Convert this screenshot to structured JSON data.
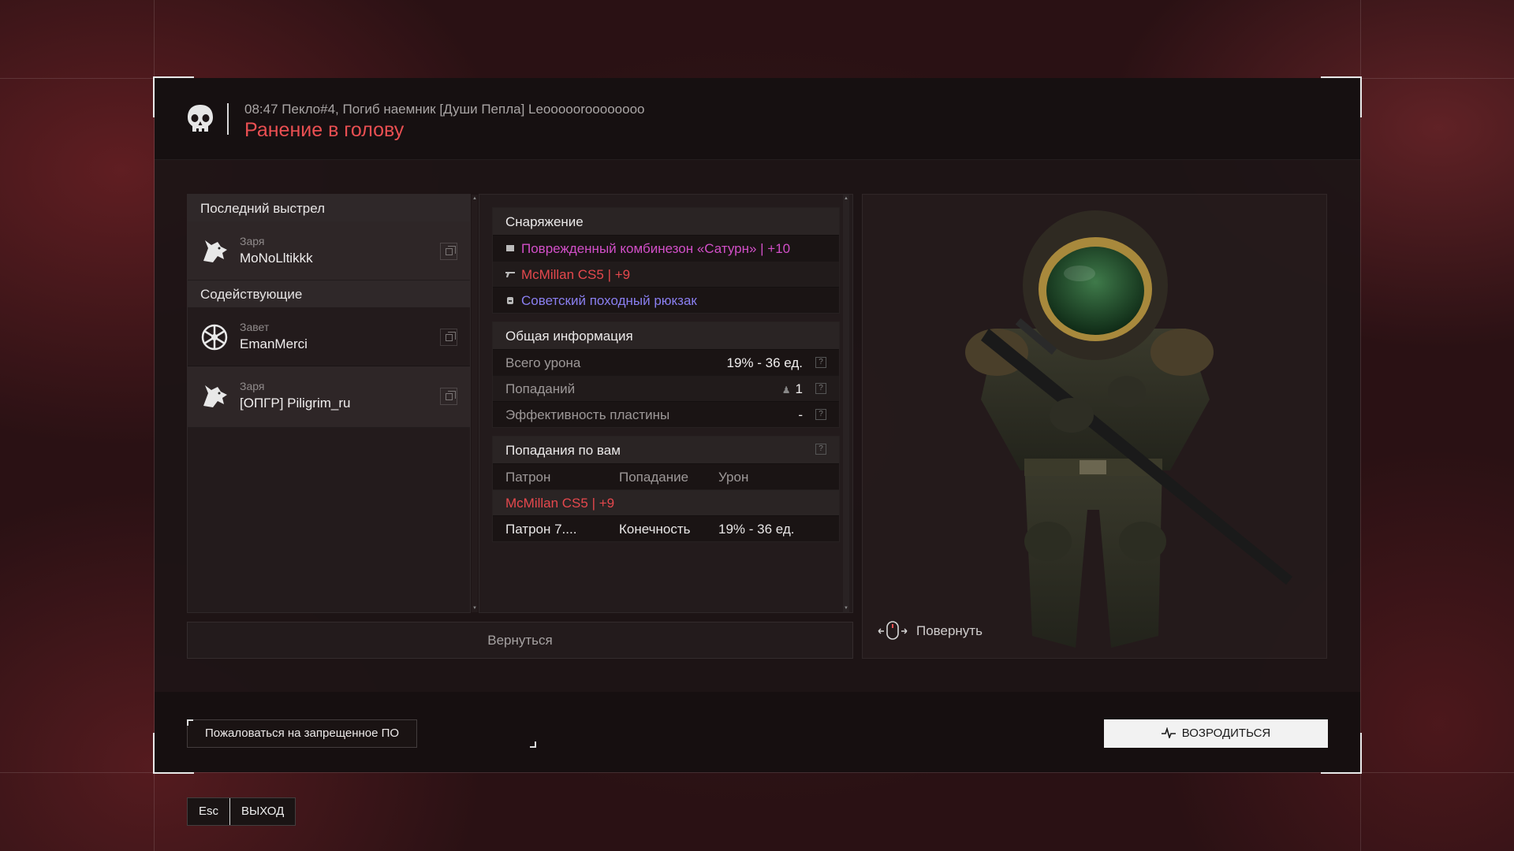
{
  "header": {
    "kill_info": "08:47 Пекло#4, Погиб наемник [Души Пепла] Leoooooroooooooo",
    "death_cause": "Ранение в голову"
  },
  "left": {
    "last_shot_title": "Последний выстрел",
    "killer": {
      "faction": "Заря",
      "name": "MoNoLltikkk"
    },
    "assistants_title": "Содействующие",
    "assistants": [
      {
        "faction": "Завет",
        "name": "EmanMerci"
      },
      {
        "faction": "Заря",
        "name": "[ОПГР] Piligrim_ru"
      }
    ]
  },
  "equipment": {
    "title": "Снаряжение",
    "items": [
      {
        "label": "Поврежденный комбинезон «Сатурн» | +10",
        "color": "#d24fc8",
        "icon": "armor-icon"
      },
      {
        "label": "McMillan CS5 | +9",
        "color": "#e5484d",
        "icon": "rifle-icon"
      },
      {
        "label": "Советский походный рюкзак",
        "color": "#8a7ff0",
        "icon": "backpack-icon"
      }
    ]
  },
  "general": {
    "title": "Общая информация",
    "total_damage_label": "Всего урона",
    "total_damage_value": "19% - 36 ед.",
    "hits_label": "Попаданий",
    "hits_value": "1",
    "plate_label": "Эффективность пластины",
    "plate_value": "-",
    "help": "?"
  },
  "hits": {
    "title": "Попадания по вам",
    "columns": [
      "Патрон",
      "Попадание",
      "Урон"
    ],
    "weapon": "McMillan CS5 | +9",
    "rows": [
      {
        "ammo": "Патрон 7....",
        "hit": "Конечность",
        "damage": "19% - 36 ед."
      }
    ]
  },
  "back_button": "Вернуться",
  "rotate_hint": "Повернуть",
  "footer": {
    "report_button": "Пожаловаться на запрещенное ПО",
    "respawn_button": "ВОЗРОДИТЬСЯ"
  },
  "esc": {
    "key": "Esc",
    "label": "ВЫХОД"
  }
}
